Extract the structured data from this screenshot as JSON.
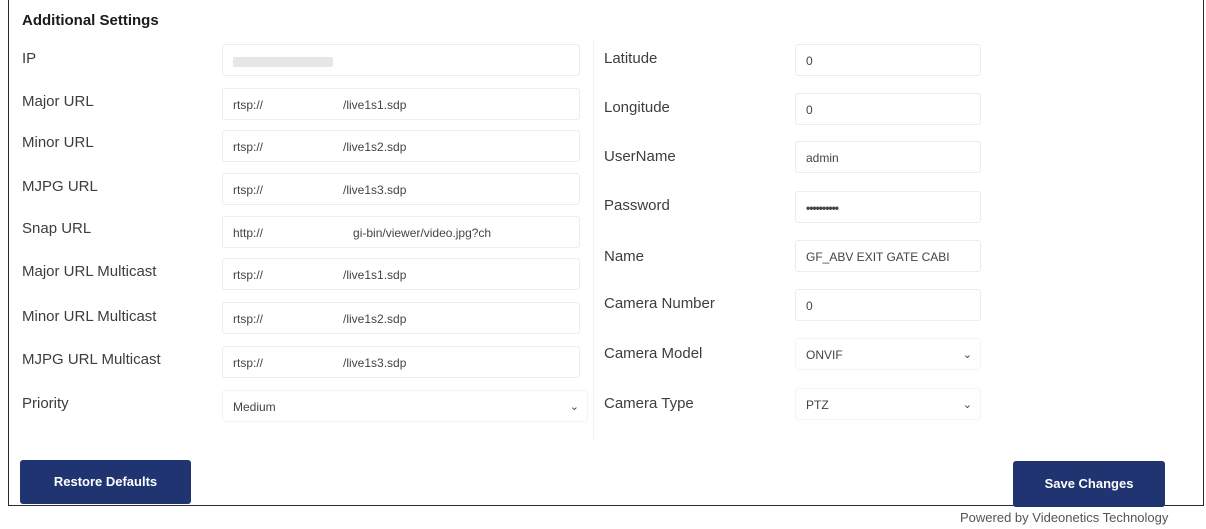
{
  "section": {
    "title": "Additional Settings"
  },
  "left": {
    "ip_label": "IP",
    "major_url_label": "Major URL",
    "major_url_prefix": "rtsp://",
    "major_url_suffix": "/live1s1.sdp",
    "minor_url_label": "Minor URL",
    "minor_url_prefix": "rtsp://",
    "minor_url_suffix": "/live1s2.sdp",
    "mjpg_url_label": "MJPG URL",
    "mjpg_url_prefix": "rtsp://",
    "mjpg_url_suffix": "/live1s3.sdp",
    "snap_url_label": "Snap URL",
    "snap_url_prefix": "http://",
    "snap_url_suffix": "gi-bin/viewer/video.jpg?ch",
    "major_multicast_label": "Major URL Multicast",
    "major_multicast_prefix": "rtsp://",
    "major_multicast_suffix": "/live1s1.sdp",
    "minor_multicast_label": "Minor URL Multicast",
    "minor_multicast_prefix": "rtsp://",
    "minor_multicast_suffix": "/live1s2.sdp",
    "mjpg_multicast_label": "MJPG URL Multicast",
    "mjpg_multicast_prefix": "rtsp://",
    "mjpg_multicast_suffix": "/live1s3.sdp",
    "priority_label": "Priority",
    "priority_value": "Medium"
  },
  "right": {
    "latitude_label": "Latitude",
    "latitude_value": "0",
    "longitude_label": "Longitude",
    "longitude_value": "0",
    "username_label": "UserName",
    "username_value": "admin",
    "password_label": "Password",
    "password_value": "••••••••••",
    "name_label": "Name",
    "name_value": "GF_ABV EXIT GATE CABI",
    "camera_number_label": "Camera Number",
    "camera_number_value": "0",
    "camera_model_label": "Camera Model",
    "camera_model_value": "ONVIF",
    "camera_type_label": "Camera Type",
    "camera_type_value": "PTZ"
  },
  "buttons": {
    "restore_label": "Restore Defaults",
    "save_label": "Save Changes"
  },
  "footer": {
    "text": "Powered by Videonetics Technology"
  },
  "icons": {
    "dropdown": "chevron-down-icon"
  },
  "colors": {
    "button_bg": "#1f3471"
  }
}
